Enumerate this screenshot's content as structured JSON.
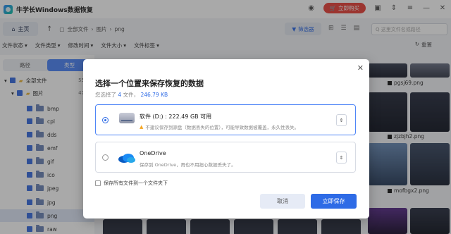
{
  "app": {
    "title": "牛学长Windows数据恢复",
    "upgrade_label": "立即购买"
  },
  "toolbar": {
    "home_label": "主页",
    "breadcrumbs": [
      "全部文件",
      "图片",
      "png"
    ],
    "filter_label": "筛选器",
    "search_placeholder": "Q 这里文件名或路径"
  },
  "filters": {
    "items": [
      "文件状态",
      "文件类型",
      "修改时间",
      "文件大小",
      "文件标签"
    ],
    "reset_label": "重置"
  },
  "sidebar": {
    "tabs": [
      "路径",
      "类型"
    ],
    "active_tab": "类型",
    "tree": [
      {
        "label": "全部文件",
        "count": "55"
      },
      {
        "label": "图片",
        "count": "47"
      },
      {
        "label": "bmp"
      },
      {
        "label": "cpl"
      },
      {
        "label": "dds"
      },
      {
        "label": "emf"
      },
      {
        "label": "gif"
      },
      {
        "label": "ico"
      },
      {
        "label": "jpeg"
      },
      {
        "label": "jpg"
      },
      {
        "label": "png"
      },
      {
        "label": "raw"
      }
    ]
  },
  "content": {
    "files": [
      "pgsj69.png",
      "zjzbjh2.png",
      "mofbgx2.png"
    ]
  },
  "dialog": {
    "title": "选择一个位置来保存恢复的数据",
    "subtitle_prefix": "您选择了",
    "selected_count": "4",
    "subtitle_mid": "文件，",
    "selected_size": "246.79 KB",
    "options": [
      {
        "name": "软件 (D:) : 222.49 GB 可用",
        "desc": "不建议保存到源盘（数据丢失的位置），可能导致数据被覆盖，永久性丢失。",
        "selected": true
      },
      {
        "name": "OneDrive",
        "desc": "保存到 OneDrive，再也不用担心数据丢失了。",
        "selected": false
      }
    ],
    "keep_label": "保存所有文件到一个文件夹下",
    "cancel_label": "取消",
    "save_label": "立即保存"
  }
}
